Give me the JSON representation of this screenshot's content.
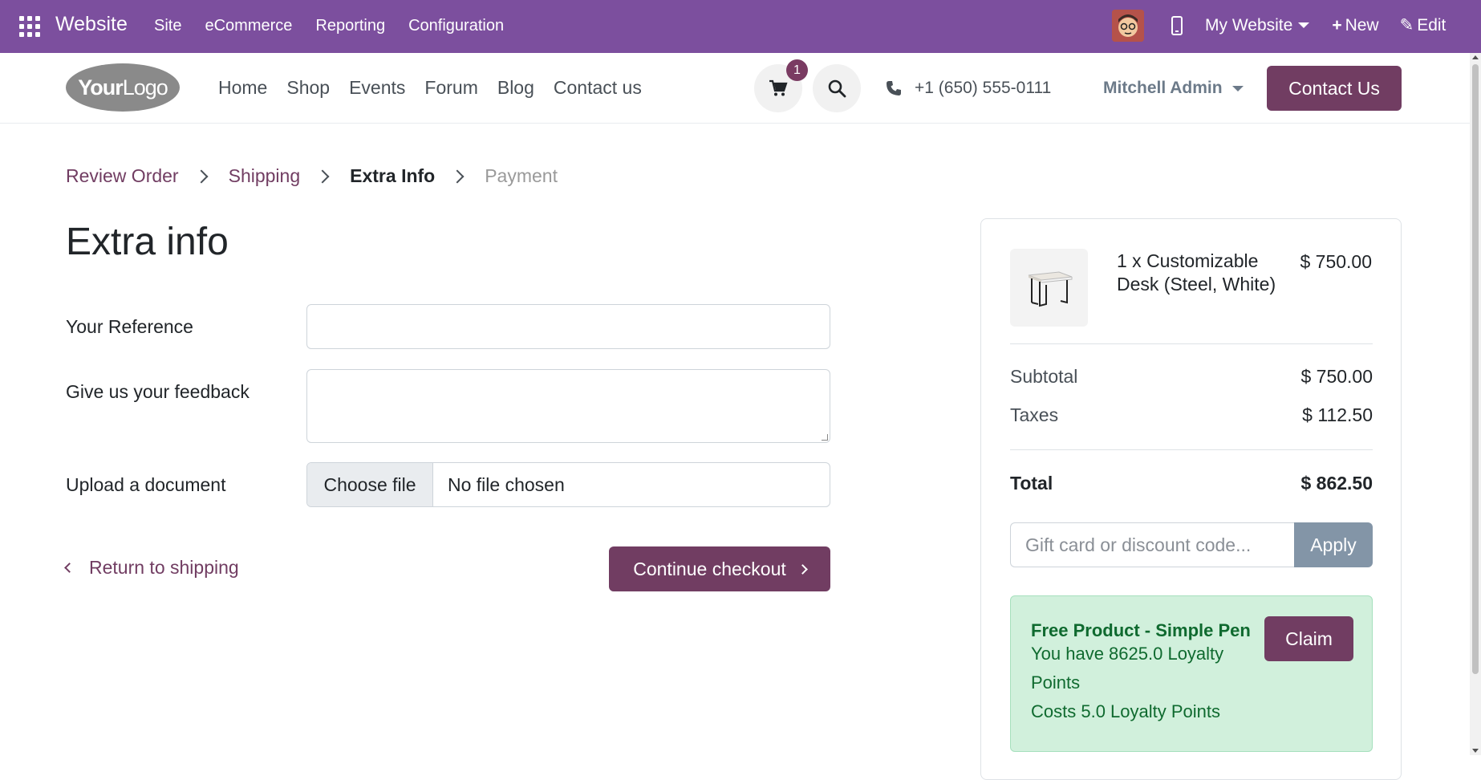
{
  "admin_bar": {
    "brand": "Website",
    "menu": [
      "Site",
      "eCommerce",
      "Reporting",
      "Configuration"
    ],
    "website_selector": "My Website",
    "new_label": "New",
    "edit_label": "Edit",
    "color": "#7c4f9e"
  },
  "header": {
    "logo_bold": "Your",
    "logo_light": "Logo",
    "nav": [
      "Home",
      "Shop",
      "Events",
      "Forum",
      "Blog",
      "Contact us"
    ],
    "cart_count": "1",
    "phone": "+1 (650) 555-0111",
    "user": "Mitchell Admin",
    "contact_button": "Contact Us"
  },
  "breadcrumb": {
    "steps": [
      "Review Order",
      "Shipping",
      "Extra Info",
      "Payment"
    ]
  },
  "page_title": "Extra info",
  "form": {
    "reference_label": "Your Reference",
    "reference_value": "",
    "feedback_label": "Give us your feedback",
    "feedback_value": "",
    "upload_label": "Upload a document",
    "choose_file": "Choose file",
    "no_file": "No file chosen",
    "return_link": "Return to shipping",
    "continue_button": "Continue checkout"
  },
  "summary": {
    "product_name": "1 x Customizable Desk (Steel, White)",
    "product_price": "$ 750.00",
    "subtotal_label": "Subtotal",
    "subtotal_value": "$ 750.00",
    "taxes_label": "Taxes",
    "taxes_value": "$ 112.50",
    "total_label": "Total",
    "total_value": "$ 862.50",
    "coupon_placeholder": "Gift card or discount code...",
    "apply_label": "Apply",
    "reward": {
      "title": "Free Product - Simple Pen",
      "points_line1": "You have 8625.0 Loyalty",
      "points_line2": "Points",
      "cost_line": "Costs 5.0 Loyalty Points",
      "claim_label": "Claim"
    }
  },
  "colors": {
    "primary": "#713d62",
    "admin_purple": "#7c4f9e",
    "reward_bg": "#d1f0dc",
    "reward_text": "#0f6a2f"
  }
}
